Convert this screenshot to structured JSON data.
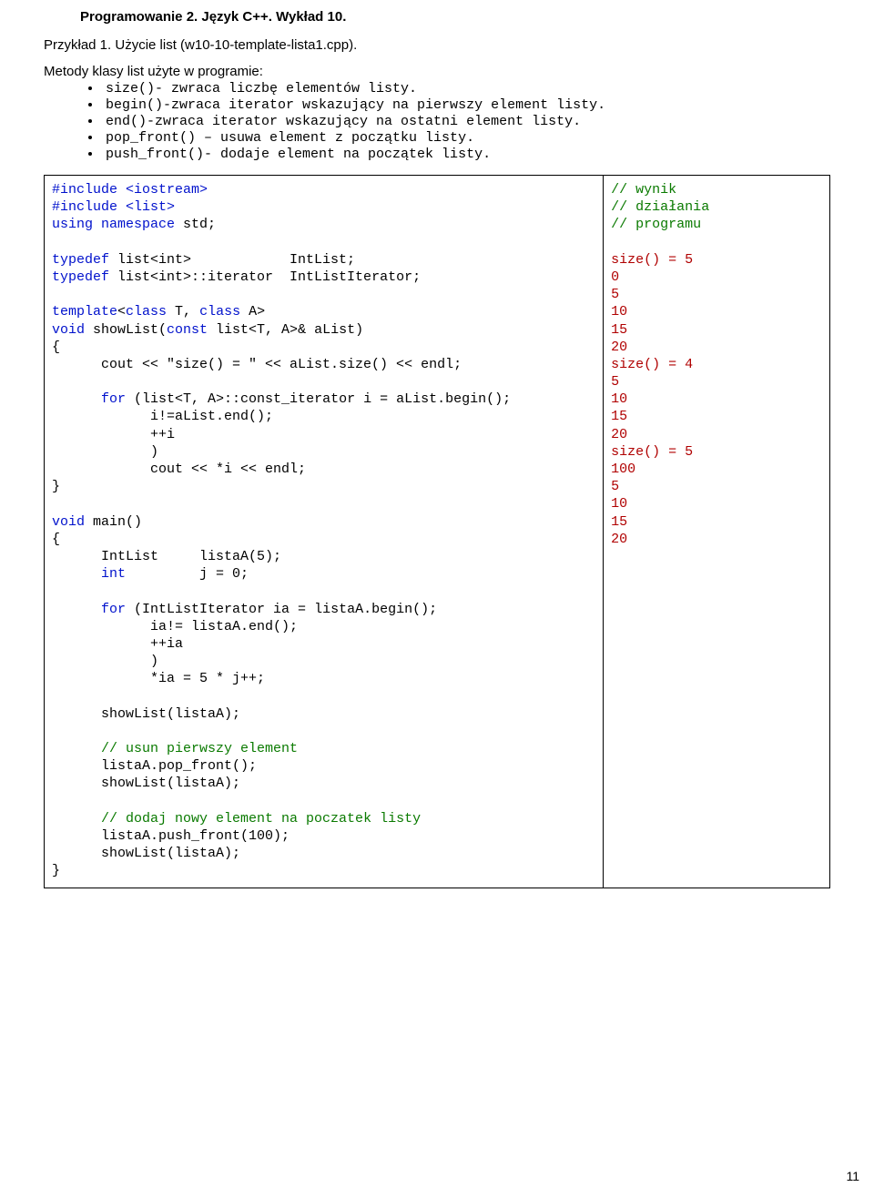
{
  "header": "Programowanie 2. Język C++. Wykład 10.",
  "example_title": "Przykład 1. Użycie list (w10-10-template-lista1.cpp).",
  "intro": "Metody klasy list użyte w programie:",
  "bullets": [
    "size()- zwraca liczbę elementów listy.",
    "begin()-zwraca iterator wskazujący na pierwszy element listy.",
    "end()-zwraca iterator wskazujący na ostatni element listy.",
    "pop_front() – usuwa element z początku listy.",
    "push_front()- dodaje element na początek listy."
  ],
  "code": {
    "inc1": "#include <iostream>",
    "inc2": "#include <list>",
    "using_kw": "using namespace",
    "std": " std;",
    "typedef_kw": "typedef",
    "list_int1": " list<int>            IntList;",
    "list_int2": " list<int>::iterator  IntListIterator;",
    "template_kw": "template",
    "template_rest": "<",
    "class_kw": "class",
    "tparam1": " T, ",
    "tparam2": " A>",
    "void_kw": "void",
    "showlist_sig": " showList(",
    "const_kw": "const",
    "showlist_sig2": " list<T, A>& aList)",
    "brace_open": "{",
    "cout_line1": "      cout << \"size() = \" << aList.size() << endl;",
    "for_kw": "for",
    "for_head": " (list<T, A>::const_iterator i = aList.begin();",
    "for_line2": "            i!=aList.end();",
    "for_line3": "            ++i",
    "for_line4": "            )",
    "for_body": "            cout << *i << endl;",
    "brace_close": "}",
    "main_sig": " main()",
    "main_line1a": "      IntList     listaA(5);",
    "int_kw": "int",
    "main_line1c": "         j = 0;",
    "for2_head": " (IntListIterator ia = listaA.begin();",
    "for2_line2": "            ia!= listaA.end();",
    "for2_line3": "            ++ia",
    "for2_line4": "            )",
    "for2_body": "            *ia = 5 * j++;",
    "show1": "      showList(listaA);",
    "comment_usun": "// usun pierwszy element",
    "pop": "      listaA.pop_front();",
    "show2": "      showList(listaA);",
    "comment_dodaj": "// dodaj nowy element na poczatek listy",
    "push": "      listaA.push_front(100);",
    "show3": "      showList(listaA);"
  },
  "output": {
    "c1": "// wynik",
    "c2": "// działania",
    "c3": "// programu",
    "lines": [
      "size() = 5",
      "0",
      "5",
      "10",
      "15",
      "20",
      "size() = 4",
      "5",
      "10",
      "15",
      "20",
      "size() = 5",
      "100",
      "5",
      "10",
      "15",
      "20"
    ]
  },
  "page_number": "11"
}
